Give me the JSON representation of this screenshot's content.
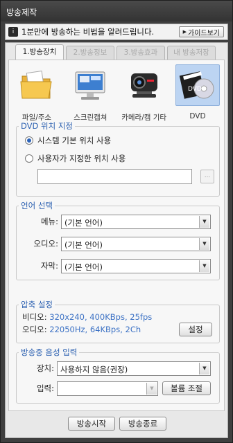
{
  "window": {
    "title": "방송제작"
  },
  "notice": {
    "text": "1분만에 방송하는 비법을 알려드립니다.",
    "guide_button": "가이드보기"
  },
  "tabs": [
    {
      "label": "1.방송장치",
      "active": true
    },
    {
      "label": "2.방송정보",
      "active": false
    },
    {
      "label": "3.방송효과",
      "active": false
    },
    {
      "label": "내 방송저장",
      "active": false
    }
  ],
  "sources": [
    {
      "label": "파일/주소",
      "icon": "folder-icon",
      "selected": false
    },
    {
      "label": "스크린캡쳐",
      "icon": "monitor-icon",
      "selected": false
    },
    {
      "label": "카메라/캠 기타",
      "icon": "webcam-icon",
      "selected": false
    },
    {
      "label": "DVD",
      "icon": "dvd-icon",
      "selected": true
    }
  ],
  "dvd_location": {
    "legend": "DVD 위치 지정",
    "option_system": "시스템 기본 위치 사용",
    "option_user": "사용자가 지정한 위치 사용",
    "selected": "system",
    "path_value": "",
    "browse_label": "..."
  },
  "language": {
    "legend": "언어 선택",
    "menu_label": "메뉴:",
    "menu_value": "(기본 언어)",
    "audio_label": "오디오:",
    "audio_value": "(기본 언어)",
    "subtitle_label": "자막:",
    "subtitle_value": "(기본 언어)"
  },
  "compression": {
    "legend": "압축 설정",
    "video_label": "비디오:",
    "video_value": "320x240, 400KBps, 25fps",
    "audio_label": "오디오:",
    "audio_value": "22050Hz, 64KBps, 2Ch",
    "settings_button": "설정"
  },
  "voice_input": {
    "legend": "방송중 음성 입력",
    "device_label": "장치:",
    "device_value": "사용하지 않음(권장)",
    "input_label": "입력:",
    "input_value": "",
    "volume_button": "볼륨 조절"
  },
  "footer": {
    "start_button": "방송시작",
    "stop_button": "방송종료"
  },
  "colors": {
    "accent": "#2a5fb0",
    "info_value": "#3a70c4",
    "selection": "#bcd4f2"
  }
}
